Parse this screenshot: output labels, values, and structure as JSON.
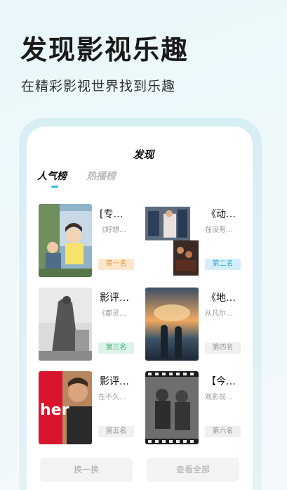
{
  "hero": {
    "title": "发现影视乐趣",
    "subtitle": "在精彩影视世界找到乐趣"
  },
  "screen": {
    "title": "发现",
    "tabs": [
      {
        "label": "人气榜",
        "active": true
      },
      {
        "label": "热播榜",
        "active": false
      }
    ]
  },
  "items": [
    {
      "title": "[专…",
      "desc": "《好想…",
      "rank": "第一名",
      "rank_style": "gold"
    },
    {
      "title": "《动…",
      "desc": "在没有…",
      "rank": "第二名",
      "rank_style": "blue"
    },
    {
      "title": "影评…",
      "desc": "《都灵…",
      "rank": "第三名",
      "rank_style": "green"
    },
    {
      "title": "《地…",
      "desc": "从凡尔…",
      "rank": "第四名",
      "rank_style": "grey"
    },
    {
      "title": "影评…",
      "desc": "在不久…",
      "rank": "第五名",
      "rank_style": "grey"
    },
    {
      "title": "【今…",
      "desc": "观影前…",
      "rank": "第六名",
      "rank_style": "grey"
    }
  ],
  "buttons": {
    "refresh": "换一换",
    "view_all": "查看全部"
  },
  "colors": {
    "accent": "#35b6e6",
    "rank_gold": "#e89a3c",
    "rank_blue": "#3aa6d9",
    "rank_green": "#3fb27a"
  }
}
